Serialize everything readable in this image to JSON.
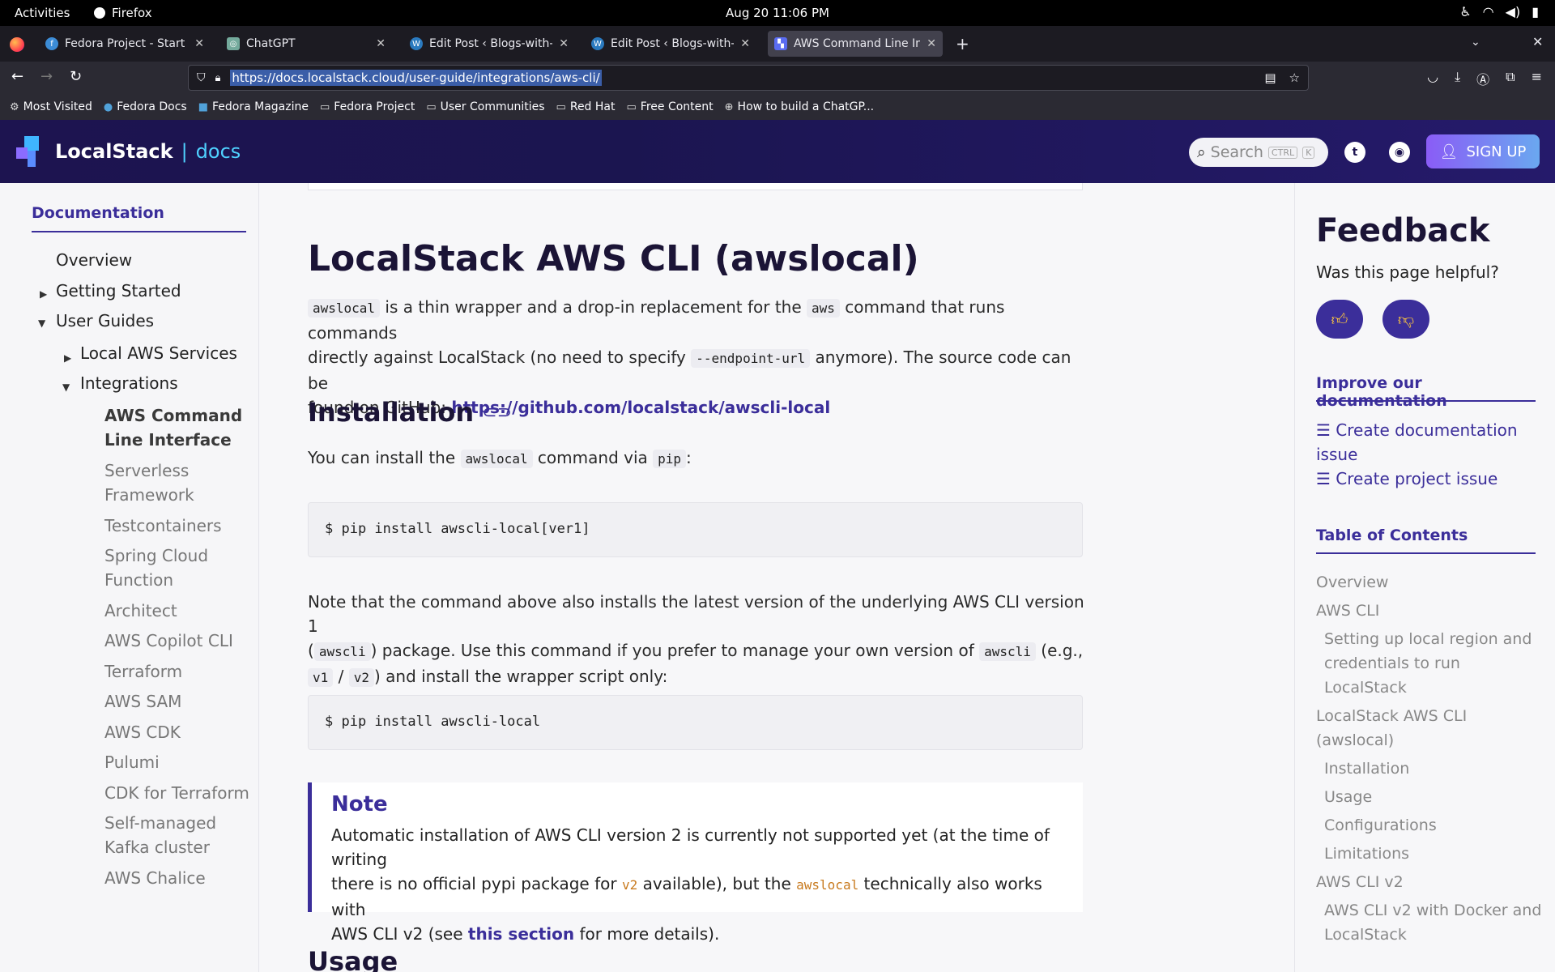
{
  "os": {
    "activities": "Activities",
    "app_name": "Firefox",
    "clock": "Aug 20  11:06 PM"
  },
  "tabs": [
    {
      "title": "Fedora Project - Start Pag"
    },
    {
      "title": "ChatGPT"
    },
    {
      "title": "Edit Post ‹ Blogs-with-Ac"
    },
    {
      "title": "Edit Post ‹ Blogs-with-Ac"
    },
    {
      "title": "AWS Command Line Inter"
    }
  ],
  "url": "https://docs.localstack.cloud/user-guide/integrations/aws-cli/",
  "bookmarks": [
    {
      "label": "Most Visited",
      "icon": "gear-icon"
    },
    {
      "label": "Fedora Docs",
      "icon": "fedora-icon"
    },
    {
      "label": "Fedora Magazine",
      "icon": "fedora-magazine-icon"
    },
    {
      "label": "Fedora Project",
      "icon": "folder-icon"
    },
    {
      "label": "User Communities",
      "icon": "folder-icon"
    },
    {
      "label": "Red Hat",
      "icon": "folder-icon"
    },
    {
      "label": "Free Content",
      "icon": "folder-icon"
    },
    {
      "label": "How to build a ChatGP...",
      "icon": "globe-icon"
    }
  ],
  "site": {
    "brand": "LocalStack",
    "sep": "|",
    "docs": "docs",
    "search_placeholder": "Search",
    "kbd1": "CTRL",
    "kbd2": "K",
    "signup": "SIGN UP"
  },
  "sidebar": {
    "title": "Documentation",
    "items": [
      {
        "label": "Overview"
      },
      {
        "label": "Getting Started"
      },
      {
        "label": "User Guides"
      },
      {
        "label": "Local AWS Services"
      },
      {
        "label": "Integrations"
      },
      {
        "label": "AWS Command"
      },
      {
        "label": "Line Interface"
      },
      {
        "label": "Serverless"
      },
      {
        "label": "Framework"
      },
      {
        "label": "Testcontainers"
      },
      {
        "label": "Spring Cloud"
      },
      {
        "label": "Function"
      },
      {
        "label": "Architect"
      },
      {
        "label": "AWS Copilot CLI"
      },
      {
        "label": "Terraform"
      },
      {
        "label": "AWS SAM"
      },
      {
        "label": "AWS CDK"
      },
      {
        "label": "Pulumi"
      },
      {
        "label": "CDK for Terraform"
      },
      {
        "label": "Self-managed"
      },
      {
        "label": "Kafka cluster"
      },
      {
        "label": "AWS Chalice"
      }
    ]
  },
  "main": {
    "title": "LocalStack AWS CLI (awslocal)",
    "intro": {
      "code1": "awslocal",
      "t1": " is a thin wrapper and a drop-in replacement for the ",
      "code2": "aws",
      "t2": " command that runs commands",
      "t3": "directly against LocalStack (no need to specify ",
      "code3": "--endpoint-url",
      "t4": " anymore). The source code can be",
      "t5": "found on GitHub: ",
      "link": "https://github.com/localstack/awscli-local"
    },
    "installation": {
      "heading": "Installation",
      "t1": "You can install the ",
      "code1": "awslocal",
      "t2": " command via ",
      "code2": "pip",
      "t3": ":",
      "cmd1": "$ pip install awscli-local[ver1]",
      "n1": "Note that the command above also installs the latest version of the underlying AWS CLI version 1",
      "n2a": "(",
      "n2code": "awscli",
      "n2b": ") package. Use this command if you prefer to manage your own version of ",
      "n2code2": "awscli",
      "n2c": " (e.g.,",
      "n3code1": "v1",
      "n3sep": " / ",
      "n3code2": "v2",
      "n3b": ") and install the wrapper script only:",
      "cmd2": "$ pip install awscli-local"
    },
    "note": {
      "title": "Note",
      "l1": "Automatic installation of AWS CLI version 2 is currently not supported yet (at the time of writing",
      "l2a": "there is no official pypi package for ",
      "l2code": "v2",
      "l2b": " available), but the ",
      "l2code2": "awslocal",
      "l2c": " technically also works with",
      "l3a": "AWS CLI v2 (see ",
      "l3link": "this section",
      "l3b": " for more details)."
    },
    "usage_heading": "Usage"
  },
  "right": {
    "feedback_title": "Feedback",
    "feedback_q": "Was this page helpful?",
    "improve": "Improve our documentation",
    "create_doc_issue_1": "Create documentation",
    "create_doc_issue_2": "issue",
    "create_project_issue": "Create project issue",
    "toc_title": "Table of Contents",
    "toc": [
      "Overview",
      "AWS CLI",
      "Setting up local region and",
      "credentials to run",
      "LocalStack",
      "LocalStack AWS CLI",
      "(awslocal)",
      "Installation",
      "Usage",
      "Configurations",
      "Limitations",
      "AWS CLI v2",
      "AWS CLI v2 with Docker and",
      "LocalStack"
    ]
  }
}
